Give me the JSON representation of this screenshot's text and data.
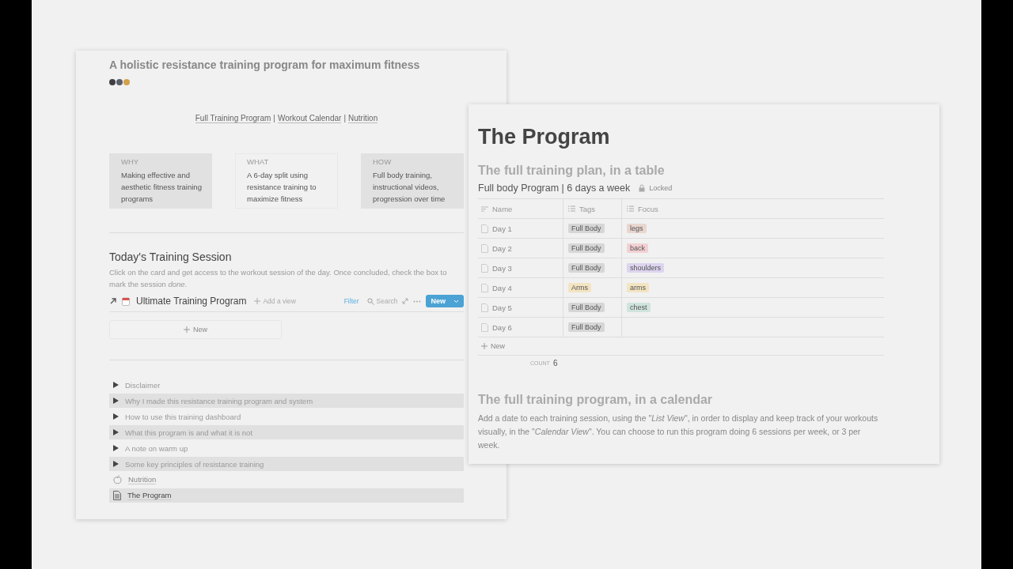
{
  "left_page": {
    "title": "A holistic resistance training program for maximum fitness",
    "dots": [
      {
        "color": "#3f3f42"
      },
      {
        "color": "#5a5d6a"
      },
      {
        "color": "#d4a04a"
      }
    ],
    "nav_items": [
      {
        "kind": "link",
        "text": "Full Training Program"
      },
      {
        "kind": "separator",
        "text": "|"
      },
      {
        "kind": "link",
        "text": "Workout Calendar"
      },
      {
        "kind": "separator",
        "text": "|"
      },
      {
        "kind": "link",
        "text": "Nutrition"
      }
    ],
    "callouts": [
      {
        "label": "WHY",
        "text": "Making effective and aesthetic fitness training programs",
        "shaded": true
      },
      {
        "label": "WHAT",
        "text": "A 6-day split using resistance training to maximize fitness",
        "shaded": false
      },
      {
        "label": "HOW",
        "text": "Full body training, instructional videos, progression over time",
        "shaded": true
      }
    ],
    "section_title": "Today's Training Session",
    "section_description": "Click on the card and get access to the workout session of the day. Once concluded, check the box to mark the session *done*.",
    "database": {
      "title": "Ultimate Training Program",
      "add_view": "Add a view",
      "filter": "Filter",
      "search": "Search",
      "new_button": "New",
      "new_card": "New"
    },
    "items": [
      {
        "kind": "toggle",
        "text": "Disclaimer",
        "shaded": false
      },
      {
        "kind": "toggle",
        "text": "Why I made this resistance training program and system",
        "shaded": true
      },
      {
        "kind": "toggle",
        "text": "How to use this training dashboard",
        "shaded": false
      },
      {
        "kind": "toggle",
        "text": "What this program is and what it is not",
        "shaded": true
      },
      {
        "kind": "toggle",
        "text": "A note on warm up",
        "shaded": false
      },
      {
        "kind": "toggle",
        "text": "Some key principles of resistance training",
        "shaded": true
      },
      {
        "kind": "link",
        "text": "Nutrition",
        "shaded": false
      },
      {
        "kind": "page",
        "text": "The Program",
        "shaded": true
      }
    ]
  },
  "right_page": {
    "title": "The Program",
    "heading": "The full training plan, in a table",
    "table_title": "Full body Program | 6 days a week",
    "locked": "Locked",
    "columns": [
      {
        "label": "Name"
      },
      {
        "label": "Tags"
      },
      {
        "label": "Focus"
      }
    ],
    "rows": [
      {
        "name": "Day 1",
        "tags": [
          {
            "text": "Full Body",
            "color": "#d6d6d6"
          }
        ],
        "focus": [
          {
            "text": "legs",
            "color": "#e8d6cf"
          }
        ]
      },
      {
        "name": "Day 2",
        "tags": [
          {
            "text": "Full Body",
            "color": "#d6d6d6"
          }
        ],
        "focus": [
          {
            "text": "back",
            "color": "#f3d0d4"
          }
        ]
      },
      {
        "name": "Day 3",
        "tags": [
          {
            "text": "Full Body",
            "color": "#d6d6d6"
          }
        ],
        "focus": [
          {
            "text": "shoulders",
            "color": "#ddd4ef"
          }
        ]
      },
      {
        "name": "Day 4",
        "tags": [
          {
            "text": "Arms",
            "color": "#f3e4c2"
          }
        ],
        "focus": [
          {
            "text": "arms",
            "color": "#f3e4c2"
          }
        ]
      },
      {
        "name": "Day 5",
        "tags": [
          {
            "text": "Full Body",
            "color": "#d6d6d6"
          }
        ],
        "focus": [
          {
            "text": "chest",
            "color": "#d0e4dd"
          }
        ]
      },
      {
        "name": "Day 6",
        "tags": [
          {
            "text": "Full Body",
            "color": "#d6d6d6"
          }
        ],
        "focus": []
      }
    ],
    "new_row": "New",
    "count_label": "COUNT",
    "count_value": "6",
    "heading2": "The full training program, in a calendar",
    "paragraph": "Add a date to each training session, using the \"*List View*\", in order to display and keep track of your workouts visually, in the \"*Calendar View*\". You can choose to run this program doing 6 sessions per week, or 3 per week."
  }
}
